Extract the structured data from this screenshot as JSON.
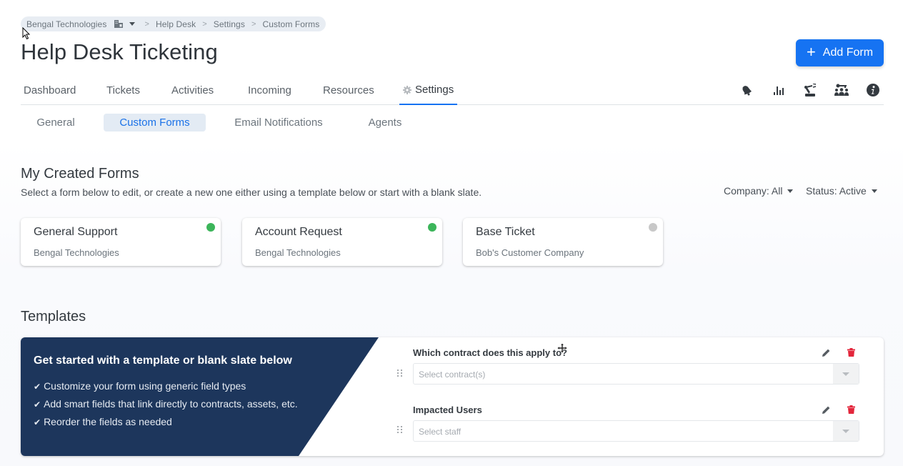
{
  "breadcrumb": {
    "company": "Bengal Technologies",
    "items": [
      "Help Desk",
      "Settings",
      "Custom Forms"
    ]
  },
  "page_title": "Help Desk Ticketing",
  "add_button": {
    "label": "Add Form",
    "icon": "plus-icon",
    "color": "#1673f2"
  },
  "main_tabs": [
    {
      "label": "Dashboard",
      "active": false
    },
    {
      "label": "Tickets",
      "active": false
    },
    {
      "label": "Activities",
      "active": false
    },
    {
      "label": "Incoming",
      "active": false
    },
    {
      "label": "Resources",
      "active": false
    },
    {
      "label": "Settings",
      "active": true,
      "icon": "gear-icon"
    }
  ],
  "tool_icons": [
    "bell-icon",
    "bar-chart-icon",
    "robot-arm-icon",
    "users-key-icon",
    "info-icon"
  ],
  "sub_tabs": [
    {
      "label": "General",
      "active": false
    },
    {
      "label": "Custom Forms",
      "active": true
    },
    {
      "label": "Email Notifications",
      "active": false
    },
    {
      "label": "Agents",
      "active": false
    }
  ],
  "my_forms": {
    "title": "My Created Forms",
    "description": "Select a form below to edit, or create a new one either using a template below or start with a blank slate.",
    "filters": {
      "company": "Company: All",
      "status": "Status: Active"
    },
    "forms": [
      {
        "name": "General Support",
        "company": "Bengal Technologies",
        "status": "active",
        "status_color": "#3cb55a"
      },
      {
        "name": "Account Request",
        "company": "Bengal Technologies",
        "status": "active",
        "status_color": "#3cb55a"
      },
      {
        "name": "Base Ticket",
        "company": "Bob's Customer Company",
        "status": "inactive",
        "status_color": "#c8c8c8"
      }
    ]
  },
  "templates": {
    "title": "Templates",
    "promo": {
      "title": "Get started with a template or blank slate below",
      "items": [
        "Customize your form using generic field types",
        "Add smart fields that link directly to contracts, assets, etc.",
        "Reorder the fields as needed"
      ],
      "bg_color": "#1d365c"
    },
    "preview_fields": [
      {
        "label": "Which contract does this apply to?",
        "placeholder": "Select contract(s)"
      },
      {
        "label": "Impacted Users",
        "placeholder": "Select staff"
      }
    ]
  }
}
